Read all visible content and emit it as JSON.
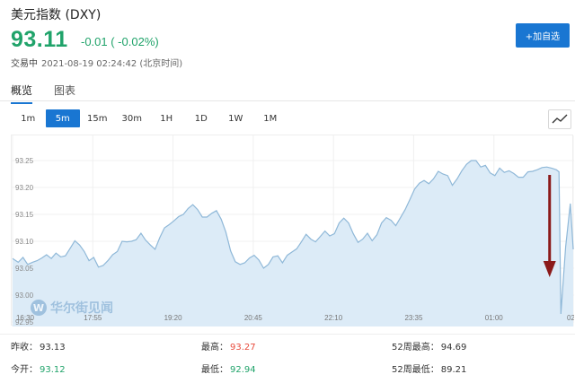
{
  "header": {
    "title": "美元指数 (DXY)",
    "price": "93.11",
    "change": "-0.01 ( -0.02%)",
    "status": "交易中",
    "timestamp": "2021-08-19 02:24:42 (北京时间)",
    "add_button": "+加自选"
  },
  "tabs": [
    {
      "label": "概览",
      "active": true
    },
    {
      "label": "图表",
      "active": false
    }
  ],
  "ranges": [
    {
      "label": "1m",
      "active": false
    },
    {
      "label": "5m",
      "active": true
    },
    {
      "label": "15m",
      "active": false
    },
    {
      "label": "30m",
      "active": false
    },
    {
      "label": "1H",
      "active": false
    },
    {
      "label": "1D",
      "active": false
    },
    {
      "label": "1W",
      "active": false
    },
    {
      "label": "1M",
      "active": false
    }
  ],
  "watermark": {
    "logo": "W",
    "text": "华尔街见闻"
  },
  "chart_data": {
    "type": "area",
    "ylim": [
      92.95,
      93.28
    ],
    "y_ticks": [
      "93.25",
      "93.20",
      "93.15",
      "93.10",
      "93.05",
      "93.00",
      "92.95"
    ],
    "x_ticks": [
      "16:30",
      "17:55",
      "19:20",
      "20:45",
      "22:10",
      "23:35",
      "01:00",
      "02:2"
    ],
    "x_range_minutes": [
      0,
      594
    ],
    "x_tick_minutes": [
      0,
      85,
      170,
      255,
      340,
      425,
      510,
      595
    ],
    "grid": true,
    "line_color": "#8fb8d8",
    "fill_color": "#dcebf7",
    "annotation": {
      "type": "arrow",
      "color": "#8b1a1a",
      "direction": "down"
    },
    "x": [
      0,
      6,
      11,
      16,
      21,
      26,
      31,
      36,
      41,
      46,
      51,
      56,
      61,
      66,
      71,
      76,
      81,
      86,
      91,
      96,
      101,
      106,
      111,
      116,
      121,
      126,
      131,
      136,
      141,
      146,
      151,
      156,
      161,
      166,
      171,
      176,
      181,
      186,
      191,
      196,
      201,
      206,
      211,
      216,
      221,
      226,
      231,
      236,
      241,
      246,
      251,
      256,
      261,
      266,
      271,
      276,
      281,
      286,
      291,
      296,
      301,
      306,
      311,
      316,
      321,
      326,
      331,
      336,
      341,
      346,
      351,
      356,
      361,
      366,
      371,
      376,
      381,
      386,
      391,
      396,
      401,
      406,
      411,
      416,
      421,
      426,
      431,
      436,
      441,
      446,
      451,
      456,
      461,
      466,
      471,
      476,
      481,
      486,
      491,
      496,
      501,
      506,
      511,
      516,
      521,
      526,
      531,
      536,
      541,
      546,
      551,
      556,
      561,
      566,
      571,
      576,
      579,
      581,
      586,
      591,
      594
    ],
    "values": [
      93.068,
      93.061,
      93.07,
      93.057,
      93.061,
      93.064,
      93.069,
      93.075,
      93.068,
      93.078,
      93.071,
      93.073,
      93.087,
      93.101,
      93.093,
      93.081,
      93.064,
      93.07,
      93.052,
      93.055,
      93.064,
      93.075,
      93.081,
      93.1,
      93.099,
      93.1,
      93.103,
      93.115,
      93.102,
      93.093,
      93.085,
      93.107,
      93.125,
      93.131,
      93.138,
      93.146,
      93.15,
      93.161,
      93.168,
      93.159,
      93.145,
      93.145,
      93.152,
      93.157,
      93.141,
      93.117,
      93.082,
      93.062,
      93.057,
      93.06,
      93.069,
      93.074,
      93.065,
      93.05,
      93.057,
      93.071,
      93.073,
      93.06,
      93.074,
      93.08,
      93.086,
      93.099,
      93.113,
      93.104,
      93.099,
      93.109,
      93.119,
      93.11,
      93.114,
      93.134,
      93.143,
      93.134,
      93.114,
      93.098,
      93.104,
      93.115,
      93.101,
      93.112,
      93.134,
      93.144,
      93.139,
      93.129,
      93.144,
      93.159,
      93.178,
      93.197,
      93.208,
      93.213,
      93.207,
      93.216,
      93.23,
      93.225,
      93.222,
      93.204,
      93.216,
      93.231,
      93.243,
      93.25,
      93.25,
      93.238,
      93.241,
      93.227,
      93.222,
      93.236,
      93.228,
      93.231,
      93.226,
      93.219,
      93.219,
      93.229,
      93.23,
      93.233,
      93.237,
      93.238,
      93.236,
      93.233,
      93.229,
      92.965,
      93.09,
      93.17,
      93.085
    ]
  },
  "stats": [
    {
      "label": "昨收：",
      "value": "93.13",
      "tone": "dark"
    },
    {
      "label": "今开：",
      "value": "93.12",
      "tone": "green"
    },
    {
      "label": "最高：",
      "value": "93.27",
      "tone": "red"
    },
    {
      "label": "最低：",
      "value": "92.94",
      "tone": "green"
    },
    {
      "label": "52周最高：",
      "value": "94.69",
      "tone": "dark"
    },
    {
      "label": "52周最低：",
      "value": "89.21",
      "tone": "dark"
    }
  ]
}
